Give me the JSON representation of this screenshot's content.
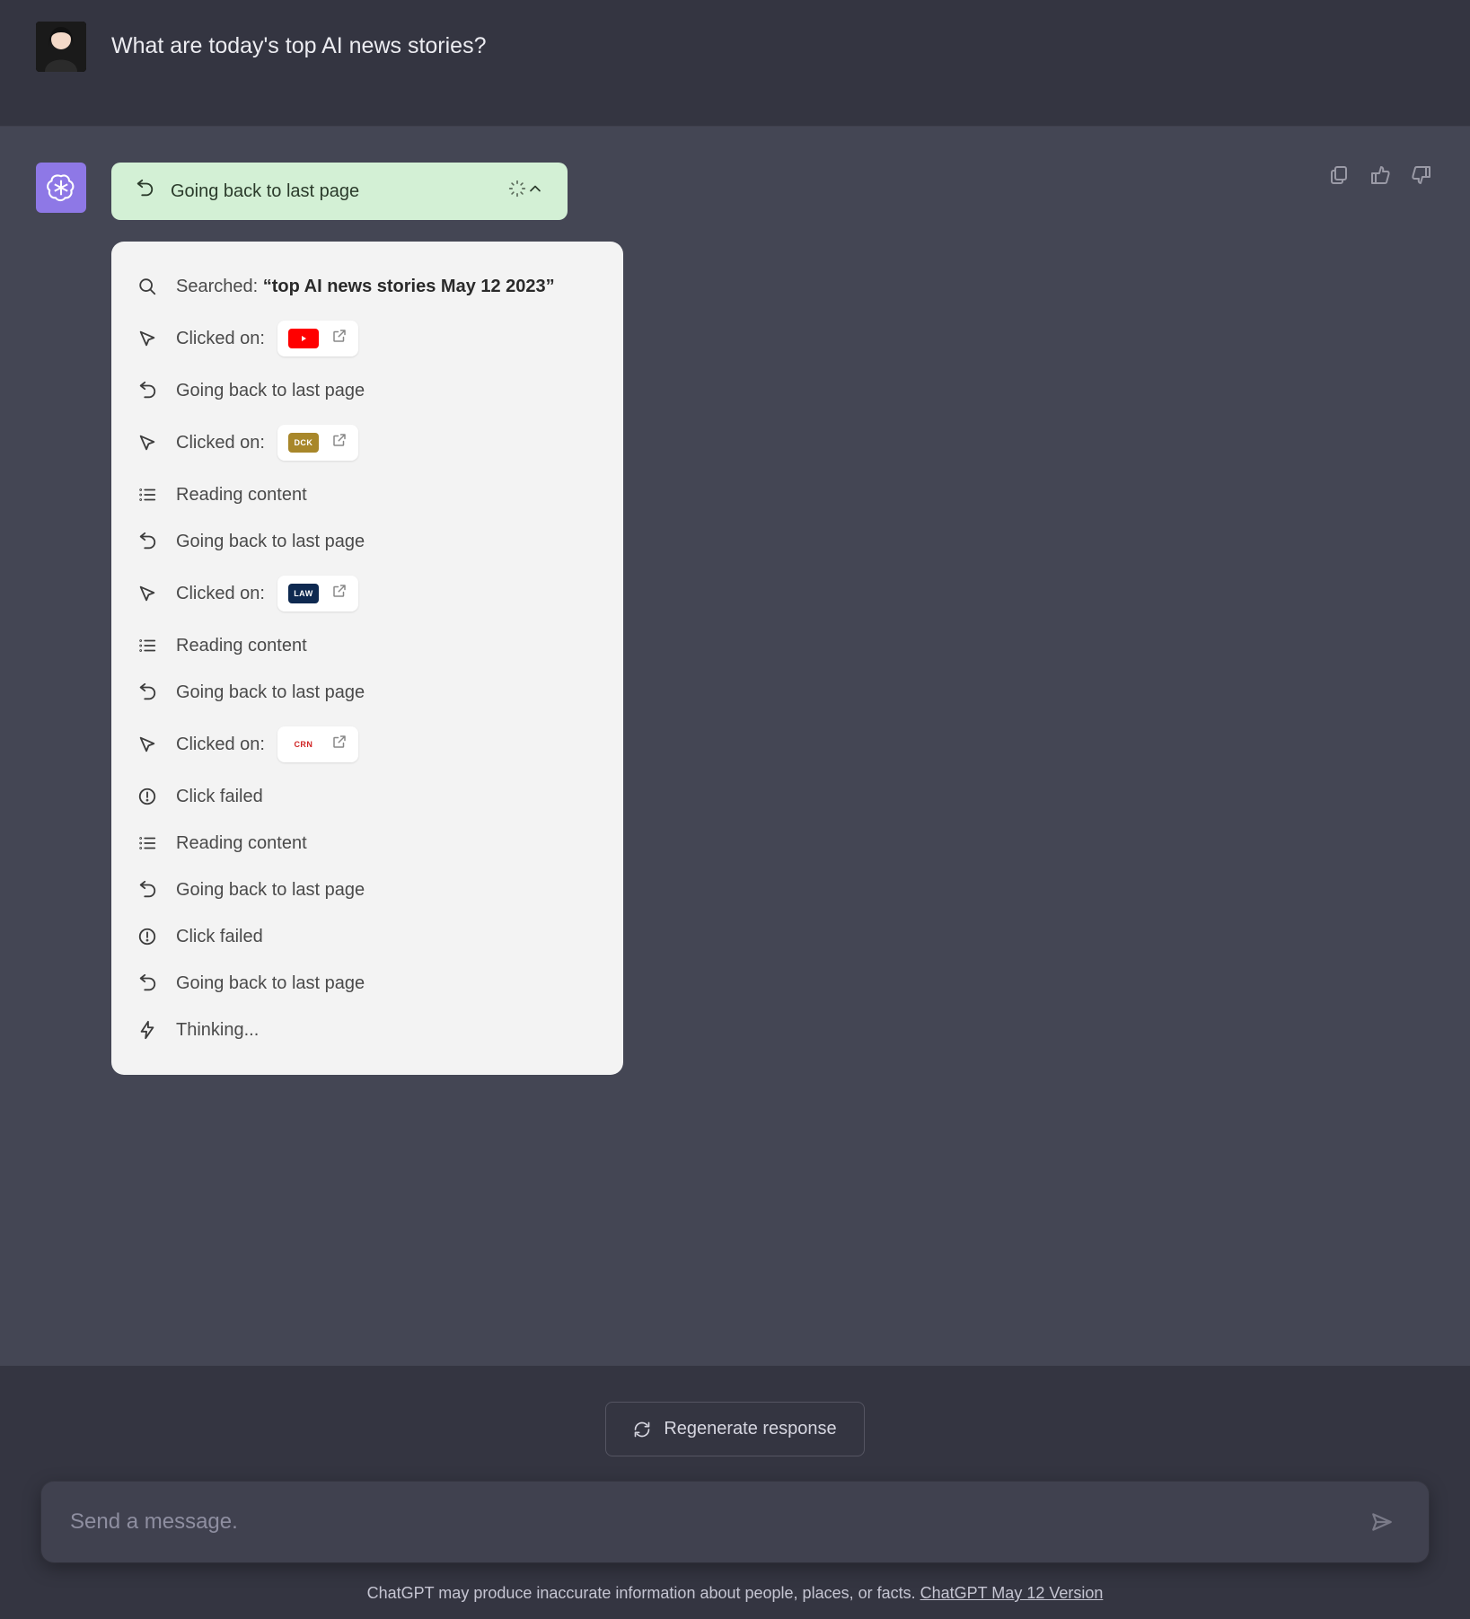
{
  "user": {
    "prompt": "What are today's top AI news stories?"
  },
  "assistant": {
    "status_pill": {
      "text": "Going back to last page"
    },
    "steps": [
      {
        "kind": "search",
        "prefix": "Searched: ",
        "bold": "“top AI news stories May 12 2023”"
      },
      {
        "kind": "click",
        "text": "Clicked on:",
        "chip": {
          "label": "",
          "bg": "#ff0000",
          "text_color": "#ffffff",
          "shape": "youtube"
        }
      },
      {
        "kind": "back",
        "text": "Going back to last page"
      },
      {
        "kind": "click",
        "text": "Clicked on:",
        "chip": {
          "label": "DCK",
          "bg": "#a8872a",
          "text_color": "#ffffff",
          "shape": "text"
        }
      },
      {
        "kind": "read",
        "text": "Reading content"
      },
      {
        "kind": "back",
        "text": "Going back to last page"
      },
      {
        "kind": "click",
        "text": "Clicked on:",
        "chip": {
          "label": "LAW",
          "bg": "#0e2950",
          "text_color": "#ffffff",
          "shape": "text"
        }
      },
      {
        "kind": "read",
        "text": "Reading content"
      },
      {
        "kind": "back",
        "text": "Going back to last page"
      },
      {
        "kind": "click",
        "text": "Clicked on:",
        "chip": {
          "label": "CRN",
          "bg": "#ffffff",
          "text_color": "#d02424",
          "shape": "text"
        }
      },
      {
        "kind": "fail",
        "text": "Click failed"
      },
      {
        "kind": "read",
        "text": "Reading content"
      },
      {
        "kind": "back",
        "text": "Going back to last page"
      },
      {
        "kind": "fail",
        "text": "Click failed"
      },
      {
        "kind": "back",
        "text": "Going back to last page"
      },
      {
        "kind": "think",
        "text": "Thinking..."
      }
    ]
  },
  "footer": {
    "regenerate": "Regenerate response",
    "input_placeholder": "Send a message.",
    "disclaimer_text": "ChatGPT may produce inaccurate information about people, places, or facts. ",
    "disclaimer_link": "ChatGPT May 12 Version"
  }
}
